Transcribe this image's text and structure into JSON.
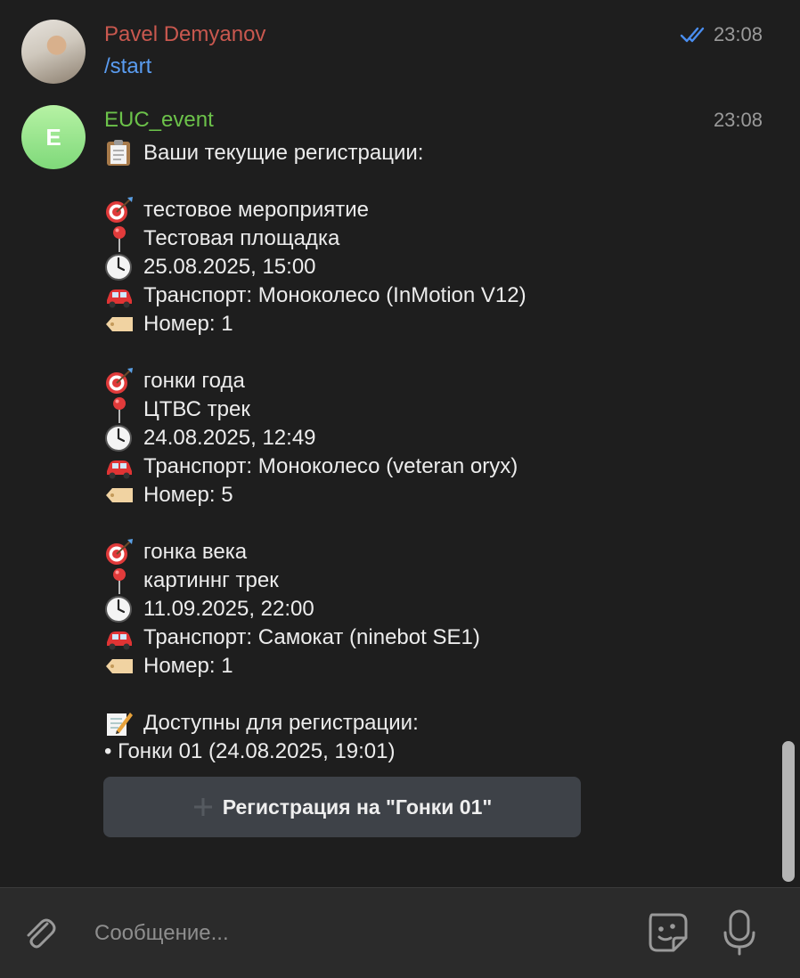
{
  "messages": [
    {
      "sender": "Pavel Demyanov",
      "sender_color": "#c9584f",
      "time": "23:08",
      "read_status_icon": "double-check-icon",
      "text": "/start"
    },
    {
      "sender": "EUC_event",
      "sender_color": "#6cc24a",
      "avatar_letter": "E",
      "time": "23:08",
      "header": "Ваши текущие регистрации:",
      "registrations": [
        {
          "event": "тестовое мероприятие",
          "place": "Тестовая площадка",
          "datetime": "25.08.2025, 15:00",
          "transport": "Транспорт: Моноколесо (InMotion V12)",
          "number": "Номер: 1"
        },
        {
          "event": "гонки года",
          "place": "ЦТВС трек",
          "datetime": "24.08.2025, 12:49",
          "transport": "Транспорт: Моноколесо (veteran oryx)",
          "number": "Номер: 5"
        },
        {
          "event": "гонка века",
          "place": "картиннг трек",
          "datetime": "11.09.2025, 22:00",
          "transport": "Транспорт: Самокат (ninebot SE1)",
          "number": "Номер: 1"
        }
      ],
      "available_header": "Доступны для регистрации:",
      "available_item": "• Гонки 01 (24.08.2025, 19:01)",
      "button_label": "Регистрация на \"Гонки 01\""
    }
  ],
  "composer": {
    "placeholder": "Сообщение..."
  },
  "colors": {
    "background": "#1e1e1e",
    "link": "#5a9cf0",
    "button_bg": "#3e4248",
    "check": "#4a8ef0"
  }
}
